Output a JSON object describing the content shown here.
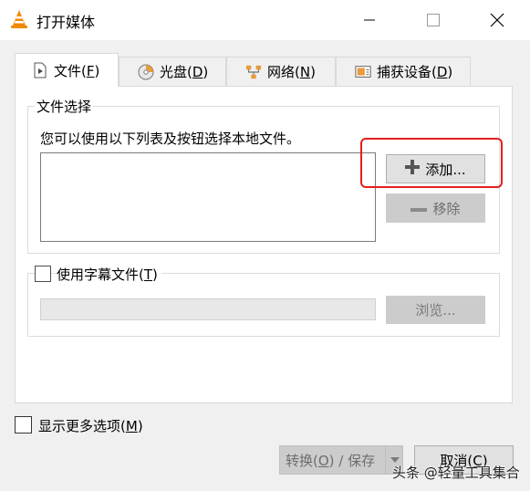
{
  "window": {
    "title": "打开媒体",
    "icon": "vlc-cone-icon",
    "controls": [
      "minimize-icon",
      "maximize-icon",
      "close-icon"
    ]
  },
  "tabs": [
    {
      "pre": "文件(",
      "key": "F",
      "post": ")",
      "icon": "file-icon",
      "active": true
    },
    {
      "pre": "光盘(",
      "key": "D",
      "post": ")",
      "icon": "disc-icon",
      "active": false
    },
    {
      "pre": "网络(",
      "key": "N",
      "post": ")",
      "icon": "network-icon",
      "active": false
    },
    {
      "pre": "捕获设备(",
      "key": "D",
      "post": ")",
      "icon": "capture-icon",
      "active": false
    }
  ],
  "file_selection": {
    "group_title": "文件选择",
    "description": "您可以使用以下列表及按钮选择本地文件。",
    "add_label": "添加...",
    "remove_label": "移除"
  },
  "subtitle": {
    "label_pre": "使用字幕文件(",
    "label_key": "T",
    "label_post": ")",
    "checked": false,
    "path_value": "",
    "browse_label": "浏览..."
  },
  "more_options": {
    "label_pre": "显示更多选项(",
    "label_key": "M",
    "label_post": ")",
    "checked": false
  },
  "footer": {
    "convert_pre": "转换(",
    "convert_key": "O",
    "convert_post": ") / 保存",
    "cancel_pre": "取消(",
    "cancel_key": "C",
    "cancel_post": ")"
  },
  "watermark": "头条 @轻量工具集合",
  "colors": {
    "highlight": "#e21f1f",
    "vlc_orange": "#f08a00"
  }
}
